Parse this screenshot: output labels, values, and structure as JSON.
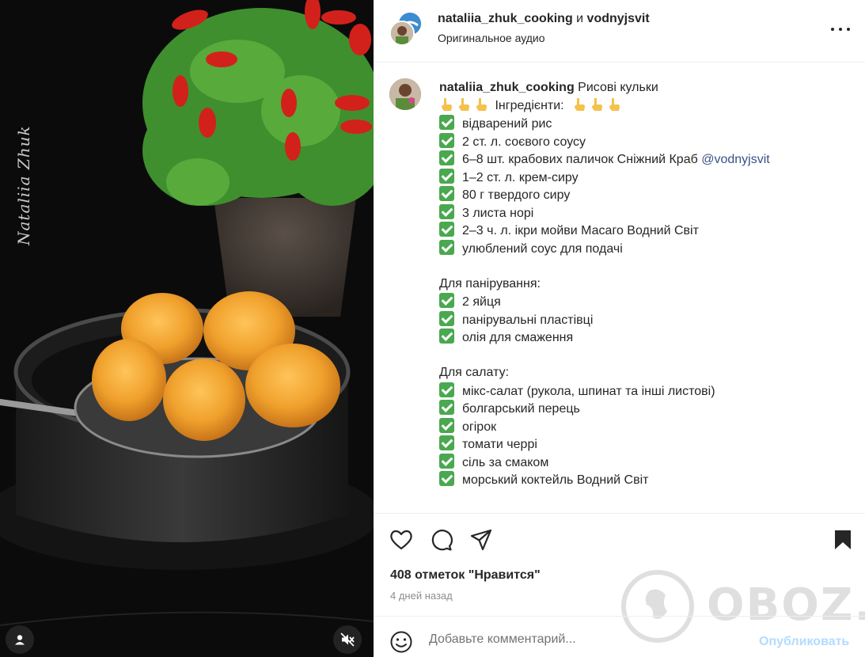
{
  "media": {
    "watermark": "Nataliia Zhuk",
    "tag_icon": "user-icon",
    "mute_icon": "muted-speaker-icon"
  },
  "header": {
    "author1": "nataliia_zhuk_cooking",
    "conjunction": " и ",
    "author2": "vodnyjsvit",
    "audio": "Оригинальное аудио",
    "more_icon": "more-dots-icon"
  },
  "caption": {
    "author": "nataliia_zhuk_cooking",
    "title": " Рисові кульки",
    "ingredients_label": "Інгредієнти:",
    "ingredients": [
      "відварений рис",
      "2 ст. л. соєвого соусу",
      "6–8 шт. крабових паличок Сніжний Краб",
      "1–2 ст. л. крем-сиру",
      "80 г твердого сиру",
      "3 листа норі",
      "2–3 ч. л. ікри мойви Масаго Водний Світ",
      "улюблений соус для подачі"
    ],
    "mention": "@vodnyjsvit",
    "breading_label": "Для панірування:",
    "breading": [
      "2 яйця",
      "панірувальні пластівці",
      "олія для смаження"
    ],
    "salad_label": "Для салату:",
    "salad": [
      "мікс-салат (рукола, шпинат та інші листові)",
      "болгарський перець",
      "огірок",
      "томати черрі",
      "сіль за смаком",
      "морський коктейль Водний Світ"
    ]
  },
  "actions": {
    "like_icon": "heart-icon",
    "comment_icon": "comment-bubble-icon",
    "share_icon": "paper-plane-icon",
    "save_icon": "bookmark-icon",
    "likes_text": "408 отметок \"Нравится\"",
    "time_text": "4 дней назад"
  },
  "comment": {
    "emoji_icon": "emoji-smile-icon",
    "placeholder": "Добавьте комментарий...",
    "post_label": "Опубликовать"
  },
  "watermark_site": "OBOZ.UA",
  "colors": {
    "check_green": "#4aa84f",
    "mention_blue": "#385185",
    "post_disabled": "#b3dbff"
  }
}
